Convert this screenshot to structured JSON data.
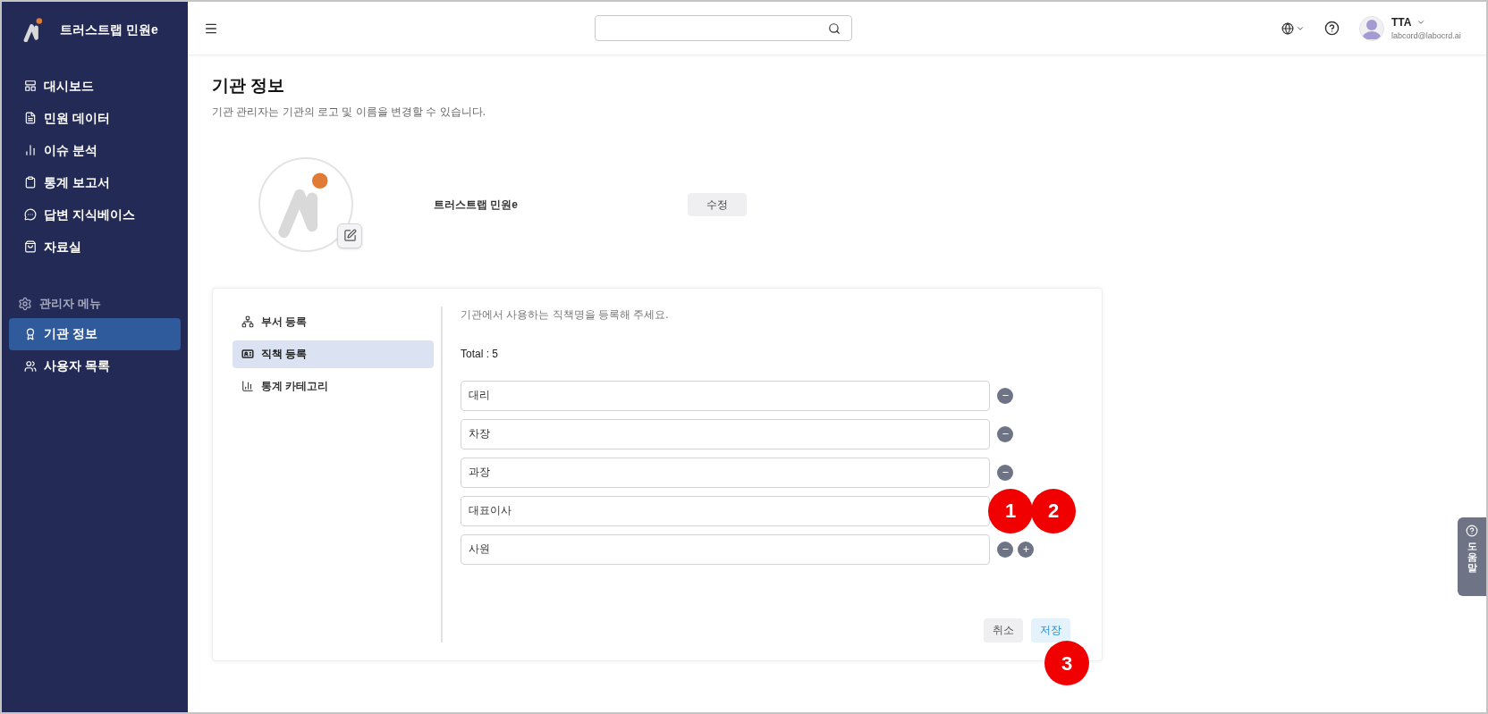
{
  "sidebar": {
    "brand": "트러스트랩 민원e",
    "items": [
      {
        "label": "대시보드",
        "selected": false
      },
      {
        "label": "민원 데이터",
        "selected": false
      },
      {
        "label": "이슈 분석",
        "selected": false
      },
      {
        "label": "통계 보고서",
        "selected": false
      },
      {
        "label": "답변 지식베이스",
        "selected": false
      },
      {
        "label": "자료실",
        "selected": false
      }
    ],
    "admin_heading": "관리자 메뉴",
    "admin_items": [
      {
        "label": "기관 정보",
        "selected": true
      },
      {
        "label": "사용자 목록",
        "selected": false
      }
    ]
  },
  "header": {
    "user": {
      "name": "TTA",
      "email": "labcord@labocrd.ai"
    }
  },
  "page": {
    "title": "기관 정보",
    "subtitle": "기관 관리자는 기관의 로고 및 이름을 변경할 수 있습니다.",
    "org_name": "트러스트랩 민원e",
    "edit_button": "수정"
  },
  "card": {
    "tabs": [
      {
        "label": "부서 등록",
        "selected": false
      },
      {
        "label": "직책 등록",
        "selected": true
      },
      {
        "label": "통계 카테고리",
        "selected": false
      }
    ],
    "description": "기관에서 사용하는 직책명을 등록해 주세요.",
    "total": "Total : 5",
    "rows": [
      {
        "value": "대리",
        "kind": "remove",
        "callouts": []
      },
      {
        "value": "차장",
        "kind": "remove",
        "callouts": []
      },
      {
        "value": "과장",
        "kind": "remove",
        "callouts": []
      },
      {
        "value": "대표이사",
        "kind": "covered",
        "callouts": [
          "1",
          "2"
        ]
      },
      {
        "value": "사원",
        "kind": "remove_add",
        "callouts": []
      }
    ],
    "cancel": "취소",
    "save": "저장",
    "save_callout": "3"
  },
  "help_tab": "도움말"
}
